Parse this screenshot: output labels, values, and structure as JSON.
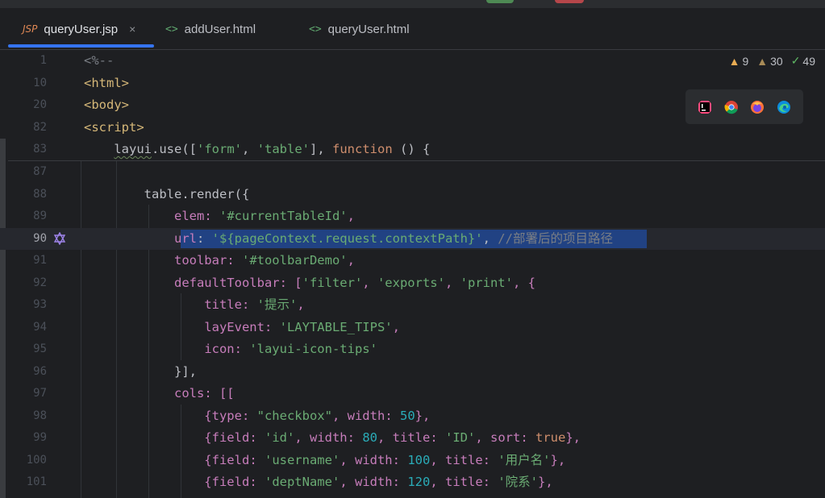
{
  "tabs": [
    {
      "label": "queryUser.jsp",
      "type_badge": "JSP",
      "active": true,
      "close": "×"
    },
    {
      "label": "addUser.html",
      "type_badge": "<>",
      "active": false
    },
    {
      "label": "queryUser.html",
      "type_badge": "<>",
      "active": false
    }
  ],
  "inspections": {
    "warnings": "9",
    "weak_warnings": "30",
    "typos": "49"
  },
  "browsers": [
    "intellij-icon",
    "chrome-icon",
    "firefox-icon",
    "edge-icon"
  ],
  "colors": {
    "accent": "#3574f0",
    "selection": "#214283",
    "background": "#1e1f22"
  },
  "sticky_lines": [
    {
      "num": "1",
      "text": "<%--"
    },
    {
      "num": "10",
      "text": "<html>"
    },
    {
      "num": "20",
      "text": "<body>"
    },
    {
      "num": "82",
      "text": "<script>"
    },
    {
      "num": "83",
      "text": "    layui.use(['form', 'table'], function () {"
    }
  ],
  "lines": [
    {
      "num": "87",
      "text": ""
    },
    {
      "num": "88",
      "text": "        table.render({"
    },
    {
      "num": "89",
      "text": "            elem: '#currentTableId',"
    },
    {
      "num": "90",
      "text": "            url: '${pageContext.request.contextPath}', //部署后的项目路径"
    },
    {
      "num": "91",
      "text": "            toolbar: '#toolbarDemo',"
    },
    {
      "num": "92",
      "text": "            defaultToolbar: ['filter', 'exports', 'print', {"
    },
    {
      "num": "93",
      "text": "                title: '提示',"
    },
    {
      "num": "94",
      "text": "                layEvent: 'LAYTABLE_TIPS',"
    },
    {
      "num": "95",
      "text": "                icon: 'layui-icon-tips'"
    },
    {
      "num": "96",
      "text": "            }],"
    },
    {
      "num": "97",
      "text": "            cols: [["
    },
    {
      "num": "98",
      "text": "                {type: \"checkbox\", width: 50},"
    },
    {
      "num": "99",
      "text": "                {field: 'id', width: 80, title: 'ID', sort: true},"
    },
    {
      "num": "100",
      "text": "                {field: 'username', width: 100, title: '用户名'},"
    },
    {
      "num": "101",
      "text": "                {field: 'deptName', width: 120, title: '院系'},"
    }
  ]
}
